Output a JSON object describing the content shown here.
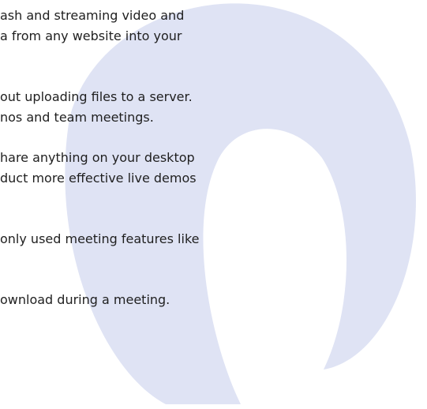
{
  "lines": [
    "ash and streaming video and",
    "a from any website into your",
    "out uploading files to a server.",
    "nos and team meetings.",
    "hare anything on your desktop",
    "duct more effective live demos",
    "only used meeting features like",
    "ownload during a meeting."
  ],
  "colors": {
    "watermark": "#dfe3f4",
    "text": "#1f1f1f",
    "background": "#ffffff"
  }
}
